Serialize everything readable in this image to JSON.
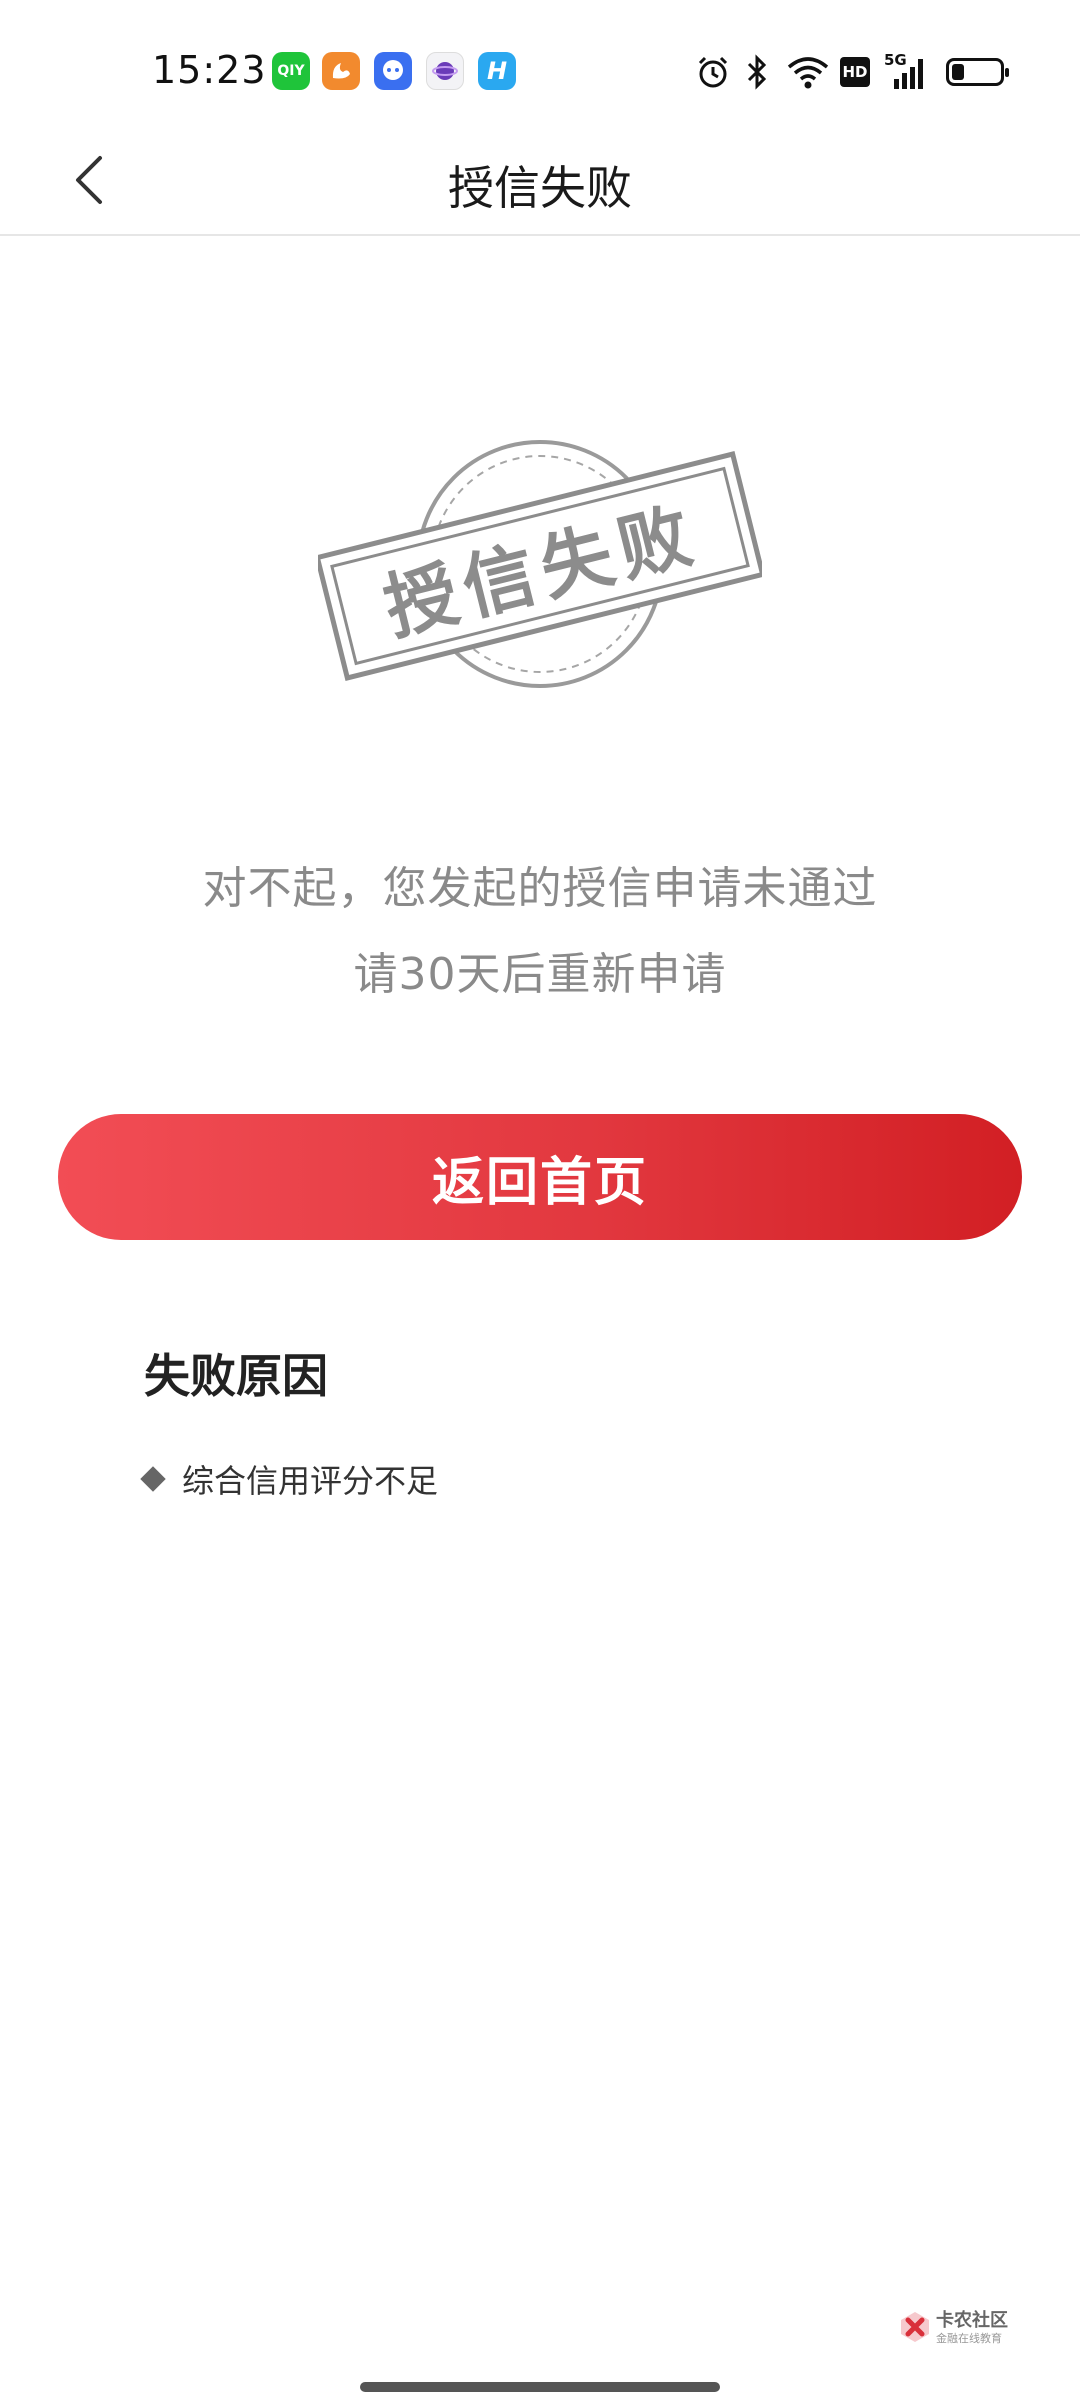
{
  "status_bar": {
    "time": "15:23",
    "app_icons": [
      {
        "name": "iqiyi-icon",
        "label": "QIY",
        "color": "#1fc43a"
      },
      {
        "name": "uc-browser-icon",
        "label": "",
        "color": "#f28a2e"
      },
      {
        "name": "chat-app-icon",
        "label": "",
        "color": "#3a6ff0"
      },
      {
        "name": "planet-app-icon",
        "label": "",
        "color": "#ffffff"
      },
      {
        "name": "h-app-icon",
        "label": "H",
        "color": "#2aa8f0"
      }
    ],
    "indicators": [
      "alarm-icon",
      "bluetooth-icon",
      "wifi-icon",
      "hd-icon",
      "signal-5g-icon",
      "battery-icon"
    ],
    "hd_label": "HD",
    "net_label": "5G"
  },
  "nav": {
    "title": "授信失败",
    "back_icon": "chevron-left-icon"
  },
  "stamp": {
    "text": "授信失败"
  },
  "message": {
    "line1": "对不起，您发起的授信申请未通过",
    "line2": "请30天后重新申请"
  },
  "button": {
    "label": "返回首页"
  },
  "reasons": {
    "title": "失败原因",
    "items": [
      "综合信用评分不足"
    ]
  },
  "watermark": {
    "title": "卡农社区",
    "subtitle": "金融在线教育"
  },
  "colors": {
    "accent_start": "#f24d55",
    "accent_end": "#d21f24",
    "muted_text": "#8a8a8a",
    "stamp_gray": "#8c8c8c"
  }
}
